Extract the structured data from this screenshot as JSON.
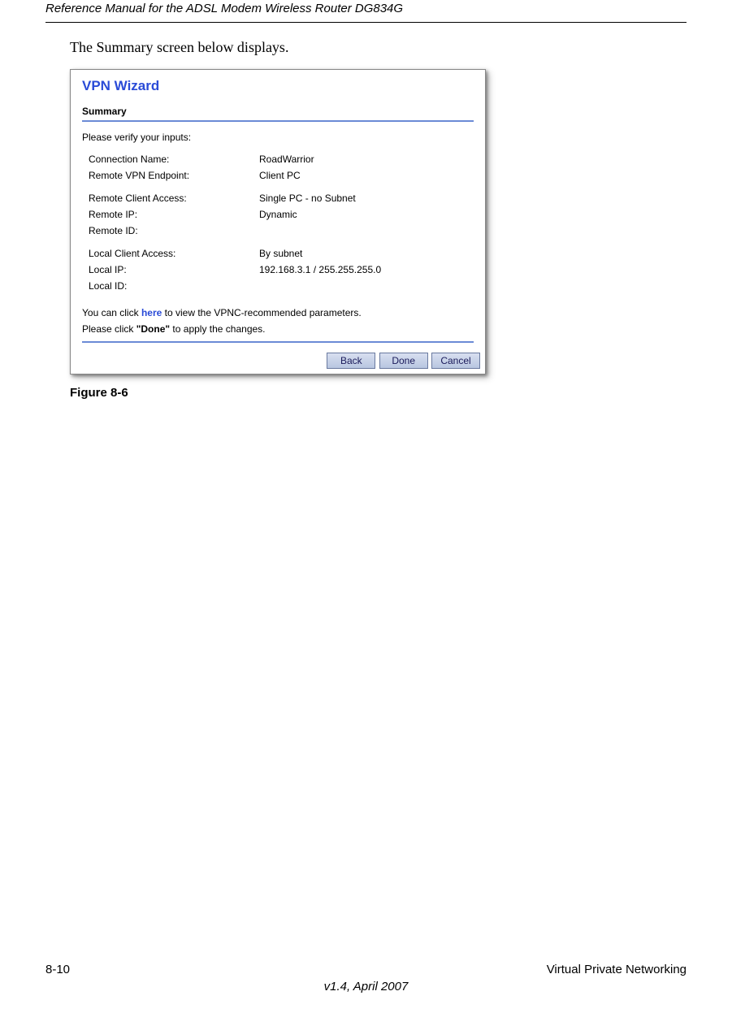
{
  "header": {
    "running_title": "Reference Manual for the ADSL Modem Wireless Router DG834G"
  },
  "body": {
    "intro_text": "The Summary screen below displays."
  },
  "wizard": {
    "title": "VPN Wizard",
    "subtitle": "Summary",
    "verify_label": "Please verify your inputs:",
    "rows": {
      "connection_name_label": "Connection Name:",
      "connection_name_value": "RoadWarrior",
      "remote_endpoint_label": "Remote VPN Endpoint:",
      "remote_endpoint_value": "Client PC",
      "remote_access_label": "Remote Client Access:",
      "remote_access_value": "Single PC - no Subnet",
      "remote_ip_label": "Remote IP:",
      "remote_ip_value": "Dynamic",
      "remote_id_label": "Remote ID:",
      "remote_id_value": "",
      "local_access_label": "Local Client Access:",
      "local_access_value": "By subnet",
      "local_ip_label": "Local IP:",
      "local_ip_value": "192.168.3.1 / 255.255.255.0",
      "local_id_label": "Local ID:",
      "local_id_value": ""
    },
    "note1_pre": "You can click ",
    "note1_link": "here",
    "note1_post": " to view the VPNC-recommended parameters.",
    "note2_pre": "Please click ",
    "note2_strong": "\"Done\"",
    "note2_post": " to apply the changes.",
    "buttons": {
      "back": "Back",
      "done": "Done",
      "cancel": "Cancel"
    }
  },
  "figure_caption": "Figure 8-6",
  "footer": {
    "page_number": "8-10",
    "section": "Virtual Private Networking",
    "version": "v1.4, April 2007"
  }
}
